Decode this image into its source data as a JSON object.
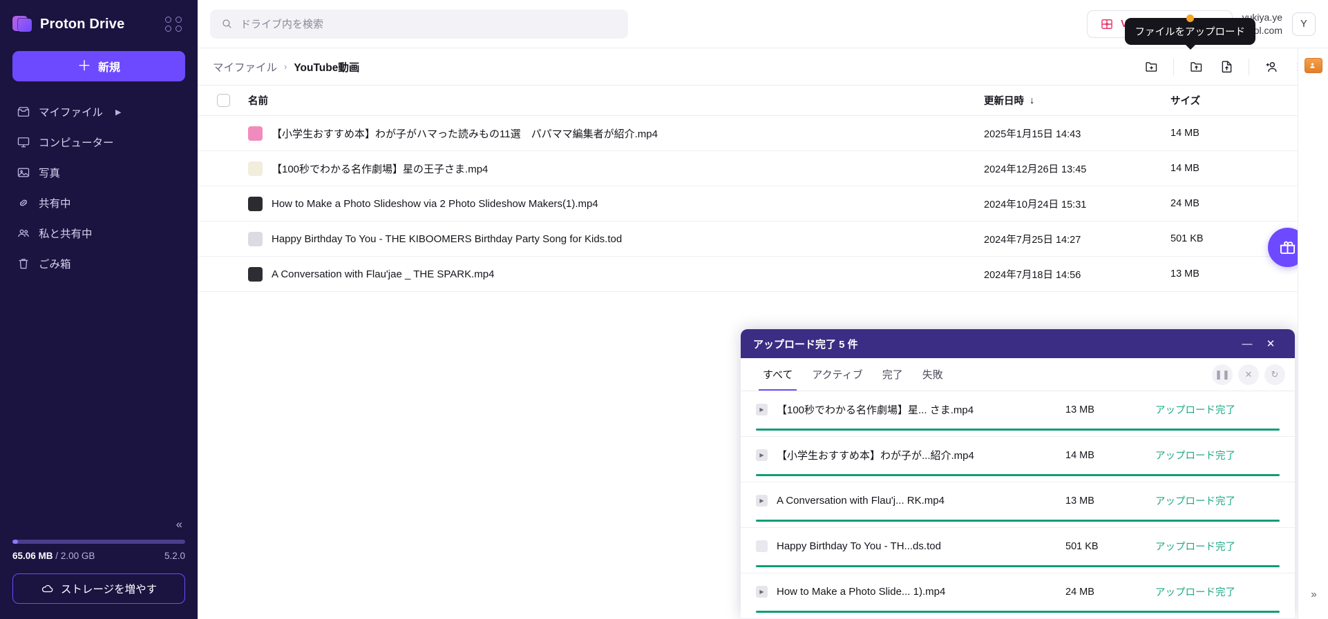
{
  "brand": {
    "name": "Proton Drive",
    "apps_icon": "apps-grid-icon"
  },
  "sidebar": {
    "new_button": "新規",
    "items": [
      {
        "label": "マイファイル",
        "icon": "inbox-icon",
        "expandable": true
      },
      {
        "label": "コンピューター",
        "icon": "monitor-icon",
        "expandable": false
      },
      {
        "label": "写真",
        "icon": "image-icon",
        "expandable": false
      },
      {
        "label": "共有中",
        "icon": "link-icon",
        "expandable": false
      },
      {
        "label": "私と共有中",
        "icon": "people-icon",
        "expandable": false
      },
      {
        "label": "ごみ箱",
        "icon": "trash-icon",
        "expandable": false
      }
    ],
    "collapse_icon": "chevron-double-left-icon",
    "storage": {
      "used": "65.06 MB",
      "separator": "/",
      "total": "2.00 GB",
      "version": "5.2.0",
      "percent": 3.2,
      "upgrade_label": "ストレージを増やす",
      "upgrade_icon": "cloud-icon"
    }
  },
  "topbar": {
    "search": {
      "placeholder": "ドライブ内を検索",
      "icon": "search-icon"
    },
    "deal_button": {
      "label": "VALENTINE'S DEAL",
      "icon": "gift-box-icon",
      "color": "#e8336a"
    },
    "user_email": "yukiya.ye\nool.com",
    "avatar_initial": "Y",
    "tooltip": "ファイルをアップロード"
  },
  "breadcrumb": {
    "root": "マイファイル",
    "separator": "›",
    "current": "YouTube動画"
  },
  "toolbar_icons": [
    {
      "name": "new-folder-icon"
    },
    {
      "name": "upload-folder-icon"
    },
    {
      "name": "upload-file-icon"
    },
    {
      "name": "share-with-user-icon"
    },
    {
      "name": "layout-grid-icon"
    }
  ],
  "file_table": {
    "columns": {
      "name": "名前",
      "modified": "更新日時",
      "size": "サイズ",
      "sort_icon": "arrow-down-icon"
    },
    "rows": [
      {
        "name": "【小学生おすすめ本】わが子がハマった読みもの11選　パパママ編集者が紹介.mp4",
        "modified": "2025年1月15日 14:43",
        "size": "14 MB",
        "thumb": "#f28bbd"
      },
      {
        "name": "【100秒でわかる名作劇場】星の王子さま.mp4",
        "modified": "2024年12月26日 13:45",
        "size": "14 MB",
        "thumb": "#f2eddc"
      },
      {
        "name": "How to Make a Photo Slideshow via 2 Photo Slideshow Makers(1).mp4",
        "modified": "2024年10月24日 15:31",
        "size": "24 MB",
        "thumb": "#2b2b30"
      },
      {
        "name": "Happy Birthday To You - THE KIBOOMERS Birthday Party Song for Kids.tod",
        "modified": "2024年7月25日 14:27",
        "size": "501 KB",
        "thumb": "#dcdbe2"
      },
      {
        "name": "A Conversation with Flau'jae _ THE SPARK.mp4",
        "modified": "2024年7月18日 14:56",
        "size": "13 MB",
        "thumb": "#302c33"
      }
    ]
  },
  "fab": {
    "icon": "gift-icon",
    "color": "#6d4aff"
  },
  "upload_panel": {
    "title": "アップロード完了 5 件",
    "minimize_icon": "minimize-icon",
    "close_icon": "close-icon",
    "tabs": [
      {
        "label": "すべて",
        "active": true
      },
      {
        "label": "アクティブ",
        "active": false
      },
      {
        "label": "完了",
        "active": false
      },
      {
        "label": "失敗",
        "active": false
      }
    ],
    "actions": [
      {
        "name": "pause-icon",
        "glyph": "❚❚"
      },
      {
        "name": "cancel-icon",
        "glyph": "✕"
      },
      {
        "name": "retry-icon",
        "glyph": "↻"
      }
    ],
    "items": [
      {
        "name": "【100秒でわかる名作劇場】星... さま.mp4",
        "size": "13 MB",
        "status": "アップロード完了",
        "progress": 100,
        "icon": "video-file-icon"
      },
      {
        "name": "【小学生おすすめ本】わが子が...紹介.mp4",
        "size": "14 MB",
        "status": "アップロード完了",
        "progress": 100,
        "icon": "video-file-icon"
      },
      {
        "name": "A Conversation with Flau'j... RK.mp4",
        "size": "13 MB",
        "status": "アップロード完了",
        "progress": 100,
        "icon": "video-file-icon"
      },
      {
        "name": "Happy Birthday To You - TH...ds.tod",
        "size": "501 KB",
        "status": "アップロード完了",
        "progress": 100,
        "icon": "generic-file-icon"
      },
      {
        "name": "How to Make a Photo Slide... 1).mp4",
        "size": "24 MB",
        "status": "アップロード完了",
        "progress": 100,
        "icon": "video-file-icon"
      }
    ],
    "status_color": "#1ea885",
    "progress_color": "#0f9d76"
  },
  "right_rail": {
    "top_icon": "contacts-icon",
    "expand_icon": "chevron-double-right-icon"
  }
}
